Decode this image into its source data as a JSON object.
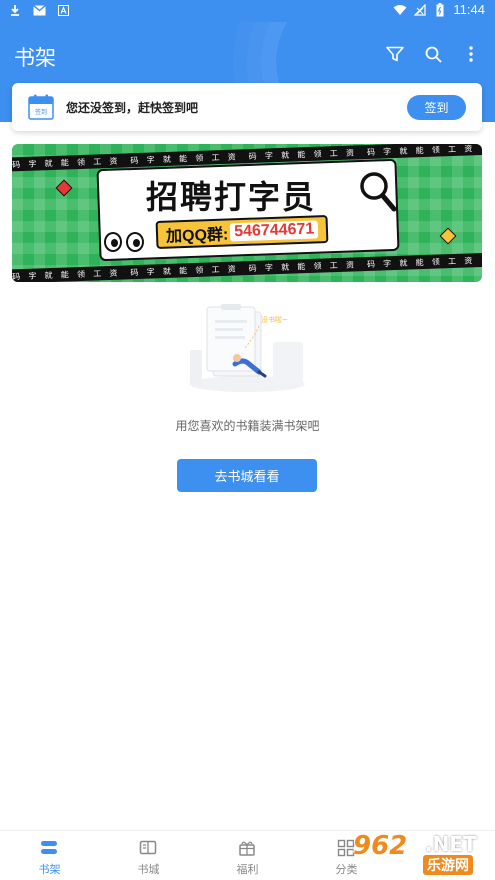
{
  "status_bar": {
    "time": "11:44",
    "icons": [
      "download-icon",
      "mail-icon",
      "a-icon",
      "wifi-icon",
      "signal-icon",
      "battery-icon"
    ]
  },
  "app_bar": {
    "title": "书架",
    "actions": [
      "filter-icon",
      "search-icon",
      "more-icon"
    ]
  },
  "signin": {
    "calendar_badge": "签到",
    "message": "您还没签到，赶快签到吧",
    "button_label": "签到"
  },
  "banner": {
    "stripe_text": "码 字 就 能 领 工 资",
    "title": "招聘打字员",
    "qq_label": "加QQ群:",
    "qq_number": "546744671"
  },
  "empty_state": {
    "illustration_caption": "没书啦~",
    "message": "用您喜欢的书籍装满书架吧",
    "button_label": "去书城看看"
  },
  "bottom_nav": {
    "items": [
      {
        "label": "书架",
        "icon": "bookshelf-icon",
        "active": true
      },
      {
        "label": "书城",
        "icon": "book-store-icon",
        "active": false
      },
      {
        "label": "福利",
        "icon": "gift-icon",
        "active": false
      },
      {
        "label": "分类",
        "icon": "grid-icon",
        "active": false
      }
    ]
  },
  "watermark": {
    "logo": "962",
    "suffix": ".NET",
    "sub": "乐游网"
  },
  "colors": {
    "primary": "#3d8ff0",
    "banner_green": "#2fb35a",
    "qq_yellow": "#f6c33a",
    "qq_red": "#e53935"
  }
}
